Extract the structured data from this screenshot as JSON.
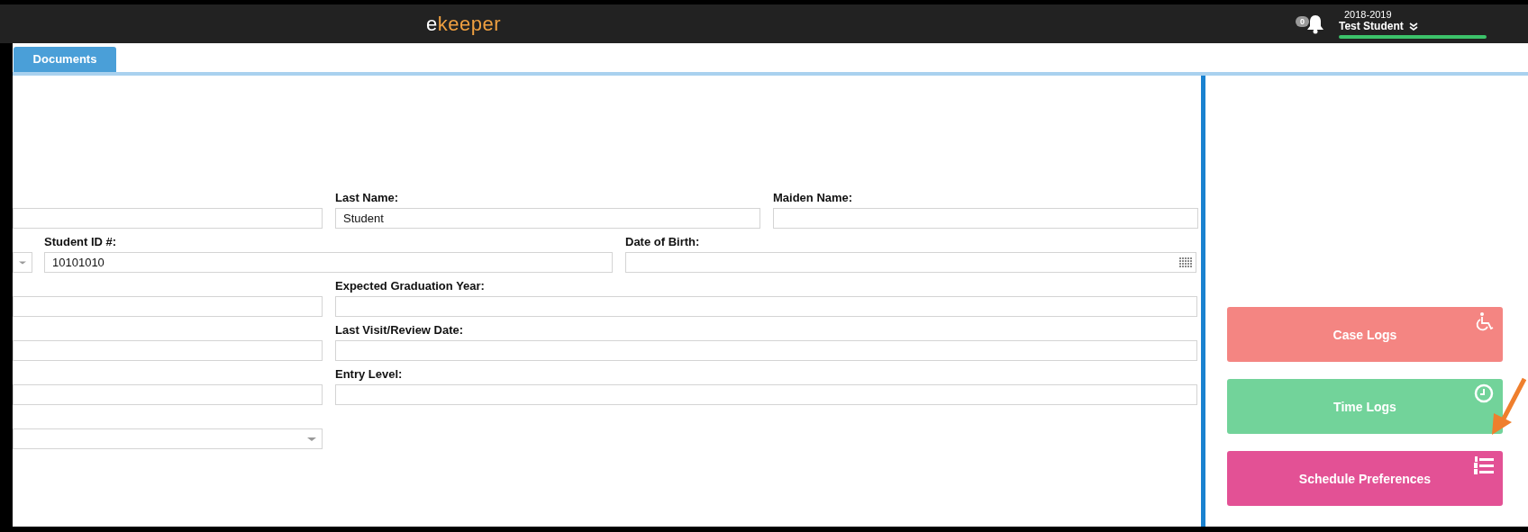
{
  "header": {
    "logo": {
      "lead": "e",
      "rest": "keeper"
    },
    "notifications": "0",
    "year": "2018-2019",
    "user": "Test Student"
  },
  "tabs": [
    {
      "label": "Documents",
      "selected": true
    }
  ],
  "form": {
    "rows": [
      {
        "kind": "three",
        "fields": [
          {
            "kind": "text"
          },
          {
            "kind": "text",
            "label": "Last Name:",
            "value": "Student"
          },
          {
            "kind": "text",
            "label": "Maiden Name:"
          }
        ]
      },
      {
        "kind": "id",
        "fields": [
          {
            "kind": "select"
          },
          {
            "kind": "text",
            "label": "Student ID #:",
            "value": "10101010"
          },
          {
            "kind": "date",
            "label": "Date of Birth:"
          }
        ]
      },
      {
        "kind": "two",
        "fields": [
          {
            "kind": "text"
          },
          {
            "kind": "text",
            "label": "Expected Graduation Year:"
          }
        ]
      },
      {
        "kind": "two",
        "fields": [
          {
            "kind": "text"
          },
          {
            "kind": "text",
            "label": "Last Visit/Review Date:"
          }
        ]
      },
      {
        "kind": "two",
        "fields": [
          {
            "kind": "text"
          },
          {
            "kind": "text",
            "label": "Entry Level:"
          }
        ]
      },
      {
        "kind": "one",
        "fields": [
          {
            "kind": "select"
          }
        ]
      }
    ]
  },
  "actions": [
    {
      "label": "Case Logs",
      "color": "#f48582",
      "kind": "wheelchair"
    },
    {
      "label": "Time Logs",
      "color": "#72d39a",
      "kind": "clock"
    },
    {
      "label": "Schedule Preferences",
      "color": "#e35195",
      "kind": "numbered-list"
    }
  ]
}
